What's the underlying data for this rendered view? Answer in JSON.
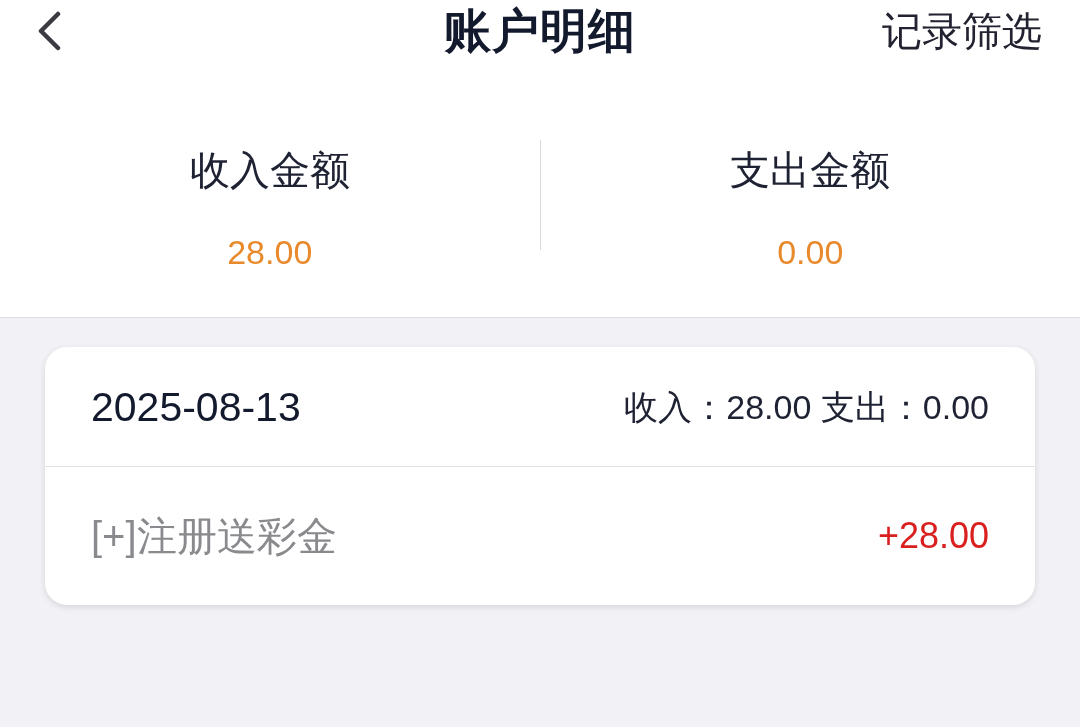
{
  "header": {
    "title": "账户明细",
    "action": "记录筛选"
  },
  "summary": [
    {
      "label": "收入金额",
      "amount": "28.00"
    },
    {
      "label": "支出金额",
      "amount": "0.00"
    }
  ],
  "days": [
    {
      "date": "2025-08-13",
      "totals": "收入：28.00 支出：0.00",
      "entries": [
        {
          "description": "[+]注册送彩金",
          "amount": "+28.00",
          "kind": "income"
        }
      ]
    }
  ]
}
